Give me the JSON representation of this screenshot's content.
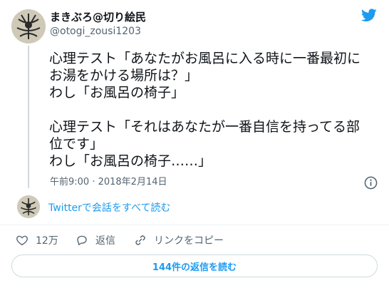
{
  "author": {
    "display_name": "まきぶろ@切り絵民",
    "handle": "@otogi_zousi1203"
  },
  "tweet": {
    "lines_block1": [
      "心理テスト「あなたがお風呂に入る時に一番最初に",
      "お湯をかける場所は？」",
      "わし「お風呂の椅子」"
    ],
    "lines_block2": [
      "心理テスト「それはあなたが一番自信を持ってる部",
      "位です」",
      "わし「お風呂の椅子……」"
    ],
    "timestamp": "午前9:00 · 2018年2月14日"
  },
  "conversation_link": "Twitterで会話をすべて読む",
  "actions": {
    "like_count": "12万",
    "reply_label": "返信",
    "copy_link_label": "リンクをコピー"
  },
  "replies_button": "144件の返信を読む",
  "colors": {
    "accent": "#1d9bf0",
    "secondary_text": "#536471",
    "primary_text": "#0f1419"
  },
  "icons": [
    "twitter-bird-icon",
    "info-icon",
    "heart-icon",
    "reply-bubble-icon",
    "link-icon"
  ]
}
